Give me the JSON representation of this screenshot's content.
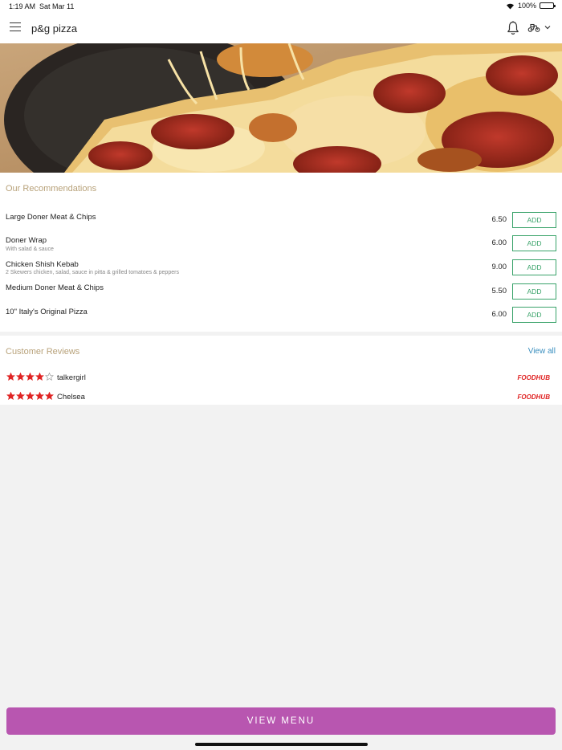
{
  "status_bar": {
    "time": "1:19 AM",
    "date": "Sat Mar 11",
    "battery": "100%"
  },
  "header": {
    "store_name": "p&g pizza",
    "icons": [
      "menu-icon",
      "bell-icon",
      "scooter-icon",
      "chevron-down-icon"
    ]
  },
  "hero": {
    "image": "pepperoni-pizza-photo"
  },
  "recommendations": {
    "title": "Our Recommendations",
    "add_label": "ADD",
    "items": [
      {
        "name": "Large Doner Meat & Chips",
        "description": "",
        "price": "6.50"
      },
      {
        "name": "Doner Wrap",
        "description": "With salad & sauce",
        "price": "6.00"
      },
      {
        "name": "Chicken Shish Kebab",
        "description": "2 Skewers chicken, salad, sauce in pitta & grilled tomatoes & peppers",
        "price": "9.00"
      },
      {
        "name": "Medium Doner Meat & Chips",
        "description": "",
        "price": "5.50"
      },
      {
        "name": "10\" Italy's Original Pizza",
        "description": "",
        "price": "6.00"
      }
    ]
  },
  "reviews": {
    "title": "Customer Reviews",
    "view_all": "View all",
    "items": [
      {
        "reviewer": "talkergirl",
        "rating": 4,
        "out_of": 5,
        "source": "FOODHUB"
      },
      {
        "reviewer": "Chelsea",
        "rating": 5,
        "out_of": 5,
        "source": "FOODHUB"
      }
    ]
  },
  "footer": {
    "view_menu_label": "VIEW MENU"
  },
  "colors": {
    "accent": "#b856b0",
    "add_green": "#3aa36a",
    "section_title": "#b8a27a",
    "link_blue": "#3a8fbf",
    "star_red": "#e02424"
  }
}
